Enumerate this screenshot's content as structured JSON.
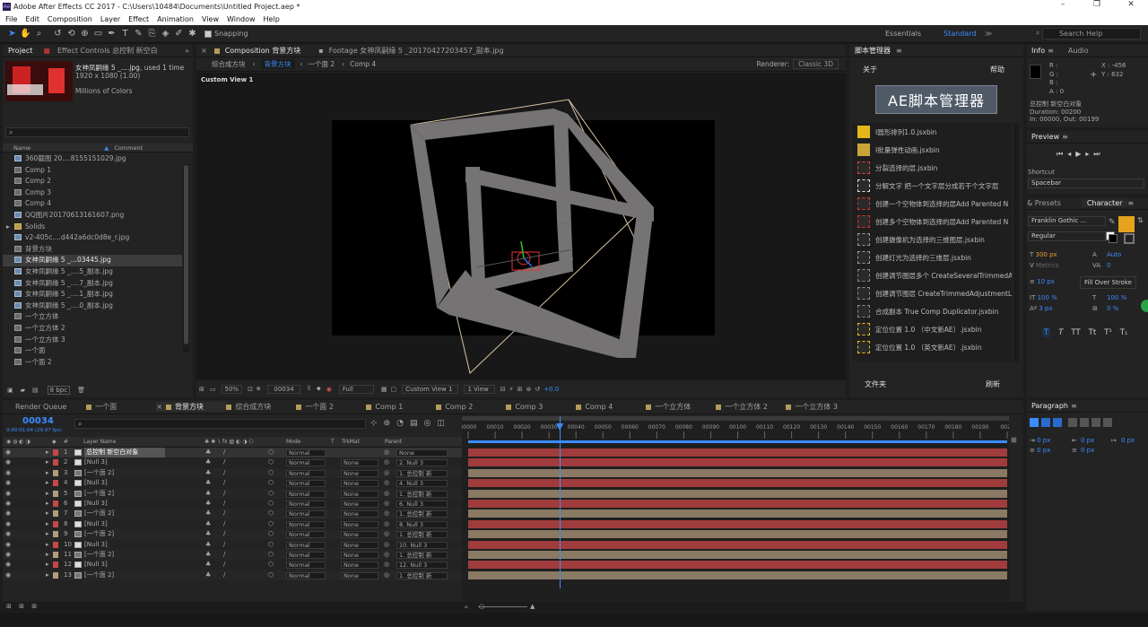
{
  "app": {
    "title": "Adobe After Effects CC 2017 - C:\\Users\\10484\\Documents\\Untitled Project.aep *",
    "menu": [
      "File",
      "Edit",
      "Composition",
      "Layer",
      "Effect",
      "Animation",
      "View",
      "Window",
      "Help"
    ],
    "snapping": "Snapping",
    "workspaces": [
      "Essentials",
      "Standard"
    ],
    "active_workspace": "Standard",
    "search_placeholder": "Search Help"
  },
  "project": {
    "tab": "Project",
    "effect_controls_tab": "Effect Controls 总控制 新空白",
    "selected_name": "女神凤嗣缘 5 _....jpg",
    "used": ", used 1 time",
    "dims": "1920 x 1080 (1.00)",
    "color": "Millions of Colors",
    "col_name": "Name",
    "col_comment": "Comment",
    "items": [
      {
        "name": "360截图 20....8155151029.jpg",
        "type": "img"
      },
      {
        "name": "Comp 1",
        "type": "comp"
      },
      {
        "name": "Comp 2",
        "type": "comp"
      },
      {
        "name": "Comp 3",
        "type": "comp"
      },
      {
        "name": "Comp 4",
        "type": "comp"
      },
      {
        "name": "QQ图片20170613161607.png",
        "type": "img"
      },
      {
        "name": "Solids",
        "type": "fold"
      },
      {
        "name": "v2-405c....d442a6dc0d8e_r.jpg",
        "type": "img"
      },
      {
        "name": "背景方块",
        "type": "comp"
      },
      {
        "name": "女神凤嗣缘 5 _...03445.jpg",
        "type": "img"
      },
      {
        "name": "女神凤嗣缘 5 _....5_副本.jpg",
        "type": "img"
      },
      {
        "name": "女神凤嗣缘 5 _....7_副本.jpg",
        "type": "img"
      },
      {
        "name": "女神凤嗣缘 5 _....1_副本.jpg",
        "type": "img"
      },
      {
        "name": "女神凤嗣缘 5 _....0_副本.jpg",
        "type": "img"
      },
      {
        "name": "一个立方体",
        "type": "comp"
      },
      {
        "name": "一个立方体 2",
        "type": "comp"
      },
      {
        "name": "一个立方体 3",
        "type": "comp"
      },
      {
        "name": "一个面",
        "type": "comp"
      },
      {
        "name": "一个面 2",
        "type": "comp"
      }
    ],
    "bpc": "8 bpc"
  },
  "comp_panel": {
    "tab_comp": "Composition 背景方块",
    "tab_footage": "Footage 女神凤嗣缘 5 _20170427203457_副本.jpg",
    "crumbs": [
      "综合成方块",
      "背景方块",
      "一个面 2",
      "Comp 4"
    ],
    "renderer_label": "Renderer:",
    "renderer": "Classic 3D",
    "view_label": "Custom View 1",
    "zoom": "50%",
    "timecode": "00034",
    "resolution": "Full",
    "view": "Custom View 1",
    "views": "1 View",
    "exposure": "+0.0"
  },
  "scripts": {
    "tab": "脚本管理器",
    "about": "关于",
    "help": "帮助",
    "logo": "AE脚本管理器",
    "items": [
      {
        "label": "I圆形排列1.0.jsxbin",
        "icon": "sun-icon"
      },
      {
        "label": "I批量弹性动画.jsxbin",
        "icon": "bars-icon"
      },
      {
        "label": "分裂选择的层.jsxbin",
        "icon": "split-icon"
      },
      {
        "label": "分解文字 把一个文字层分成若干个文字层",
        "icon": "text-split-icon"
      },
      {
        "label": "创建一个空物体到选择的层Add Parented N",
        "icon": "null-icon"
      },
      {
        "label": "创建多个空物体到选择的层Add Parented N",
        "icon": "nulls-icon"
      },
      {
        "label": "创建摄像机为选择的三维图层.jsxbin",
        "icon": "camera-icon"
      },
      {
        "label": "创建灯光为选择的三维层.jsxbin",
        "icon": "light-icon"
      },
      {
        "label": "创建调节图层多个 CreateSeveralTrimmedAd",
        "icon": "adjust-multi-icon"
      },
      {
        "label": "创建调节图层 CreateTrimmedAdjustmentLay",
        "icon": "adjust-icon"
      },
      {
        "label": "合成副本 True Comp Duplicator.jsxbin",
        "icon": "dup-icon"
      },
      {
        "label": "定位位置 1.0 （中文新AE）.jsxbin",
        "icon": "pos-icon"
      },
      {
        "label": "定位位置 1.0 （英文新AE）.jsxbin",
        "icon": "pos2-icon"
      }
    ],
    "folder": "文件夹",
    "refresh": "刷新"
  },
  "info": {
    "tabs": [
      "Info",
      "Audio"
    ],
    "r": "R :",
    "g": "G :",
    "b": "B :",
    "a": "A : 0",
    "x": "X : -456",
    "y": "Y : 632",
    "layer": "总控制 新空白对象",
    "duration": "Duration: 00200",
    "inout": "In: 00000, Out: 00199"
  },
  "preview": {
    "tab": "Preview",
    "shortcut_label": "Shortcut",
    "shortcut": "Spacebar"
  },
  "character": {
    "tabs": [
      "& Presets",
      "Character"
    ],
    "font": "Franklin Gothic ...",
    "style": "Regular",
    "size": "300 px",
    "leading": "Auto",
    "kerning": "Metrics",
    "tracking": "0",
    "stroke": "10 px",
    "stroke_mode": "Fill Over Stroke",
    "vscale": "100 %",
    "hscale": "100 %",
    "baseline": "3 px",
    "tsume": "0 %",
    "styles": [
      "T",
      "T",
      "TT",
      "Tt",
      "T¹",
      "T₁"
    ],
    "color_fill": "#e6a21c",
    "color_badge": "#27a447"
  },
  "paragraph": {
    "tab": "Paragraph",
    "indent": [
      "0 px",
      "0 px",
      "0 px",
      "0 px",
      "0 px"
    ]
  },
  "timeline": {
    "render_queue": "Render Queue",
    "tabs": [
      "一个面",
      "背景方块",
      "综合成方块",
      "一个面 2",
      "Comp 1",
      "Comp 2",
      "Comp 3",
      "Comp 4",
      "一个立方体",
      "一个立方体 2",
      "一个立方体 3"
    ],
    "active_tab": "背景方块",
    "timecode": "00034",
    "timecode_sub": "0:00:01:04 (29.97 fps)",
    "cols": {
      "layer_name": "Layer Name",
      "mode": "Mode",
      "t": "T",
      "trkmat": "TrkMat",
      "parent": "Parent"
    },
    "ruler": [
      "00000",
      "00010",
      "00020",
      "00030",
      "00040",
      "00050",
      "00060",
      "00070",
      "00080",
      "00090",
      "00100",
      "00110",
      "00120",
      "00130",
      "00140",
      "00150",
      "00160",
      "00170",
      "00180",
      "00190",
      "0020"
    ],
    "playhead_frame": 34,
    "total_frames": 200,
    "layers": [
      {
        "n": "1",
        "name": "总控制 新空白对象",
        "mode": "Normal",
        "trk": "",
        "parent": "None",
        "color": "#c44848",
        "type": "null",
        "bar": "#a13c3c"
      },
      {
        "n": "2",
        "name": "[Null 3]",
        "mode": "Normal",
        "trk": "None",
        "parent": "2. Null 3",
        "color": "#c44848",
        "type": "null",
        "bar": "#a13c3c"
      },
      {
        "n": "3",
        "name": "[一个面 2]",
        "mode": "Normal",
        "trk": "None",
        "parent": "1. 总控制 新",
        "color": "#b19d7e",
        "type": "comp",
        "bar": "#8a7a64"
      },
      {
        "n": "4",
        "name": "[Null 3]",
        "mode": "Normal",
        "trk": "None",
        "parent": "4. Null 3",
        "color": "#c44848",
        "type": "null",
        "bar": "#a13c3c"
      },
      {
        "n": "5",
        "name": "[一个面 2]",
        "mode": "Normal",
        "trk": "None",
        "parent": "1. 总控制 新",
        "color": "#b19d7e",
        "type": "comp",
        "bar": "#8a7a64"
      },
      {
        "n": "6",
        "name": "[Null 3]",
        "mode": "Normal",
        "trk": "None",
        "parent": "6. Null 3",
        "color": "#c44848",
        "type": "null",
        "bar": "#a13c3c"
      },
      {
        "n": "7",
        "name": "[一个面 2]",
        "mode": "Normal",
        "trk": "None",
        "parent": "1. 总控制 新",
        "color": "#b19d7e",
        "type": "comp",
        "bar": "#8a7a64"
      },
      {
        "n": "8",
        "name": "[Null 3]",
        "mode": "Normal",
        "trk": "None",
        "parent": "8. Null 3",
        "color": "#c44848",
        "type": "null",
        "bar": "#a13c3c"
      },
      {
        "n": "9",
        "name": "[一个面 2]",
        "mode": "Normal",
        "trk": "None",
        "parent": "1. 总控制 新",
        "color": "#b19d7e",
        "type": "comp",
        "bar": "#8a7a64"
      },
      {
        "n": "10",
        "name": "[Null 3]",
        "mode": "Normal",
        "trk": "None",
        "parent": "10. Null 3",
        "color": "#c44848",
        "type": "null",
        "bar": "#a13c3c"
      },
      {
        "n": "11",
        "name": "[一个面 2]",
        "mode": "Normal",
        "trk": "None",
        "parent": "1. 总控制 新",
        "color": "#b19d7e",
        "type": "comp",
        "bar": "#8a7a64"
      },
      {
        "n": "12",
        "name": "[Null 3]",
        "mode": "Normal",
        "trk": "None",
        "parent": "12. Null 3",
        "color": "#c44848",
        "type": "null",
        "bar": "#a13c3c"
      },
      {
        "n": "13",
        "name": "[一个面 2]",
        "mode": "Normal",
        "trk": "None",
        "parent": "1. 总控制 新",
        "color": "#b19d7e",
        "type": "comp",
        "bar": "#8a7a64"
      }
    ]
  }
}
